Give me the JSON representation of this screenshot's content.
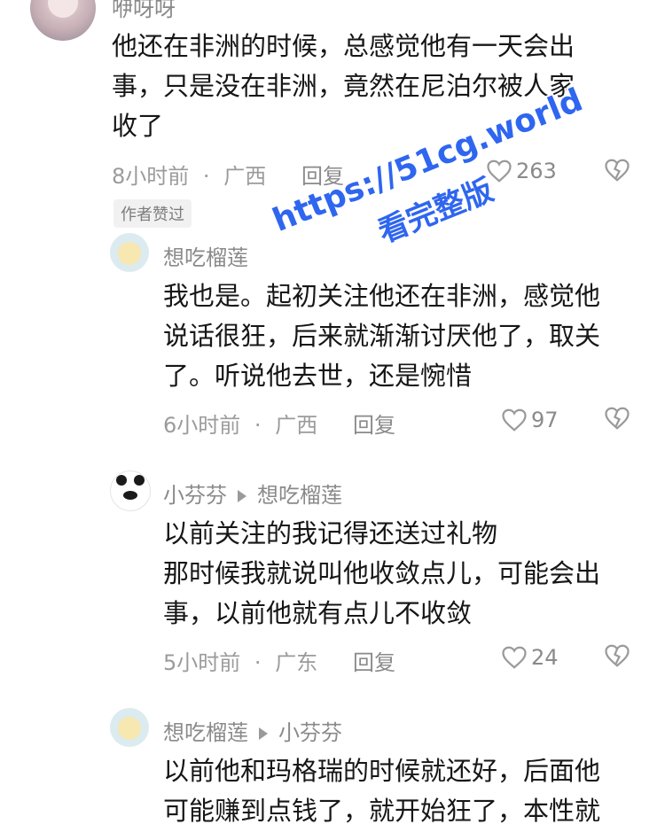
{
  "comments": [
    {
      "username": "咿呀呀",
      "lines": [
        "他还在非洲的时候，总感觉他有一天会出",
        "事，只是没在非洲，竟然在尼泊尔被人家",
        "收了"
      ],
      "time": "8小时前",
      "location": "广西",
      "reply_label": "回复",
      "likes": "263",
      "badge": "作者赞过"
    },
    {
      "username": "想吃榴莲",
      "lines": [
        "我也是。起初关注他还在非洲，感觉他",
        "说话很狂，后来就渐渐讨厌他了，取关",
        "了。听说他去世，还是惋惜"
      ],
      "time": "6小时前",
      "location": "广西",
      "reply_label": "回复",
      "likes": "97"
    },
    {
      "username": "小芬芬",
      "reply_to": "想吃榴莲",
      "lines": [
        "以前关注的我记得还送过礼物",
        "那时候我就说叫他收敛点儿，可能会出",
        "事，以前他就有点儿不收敛"
      ],
      "time": "5小时前",
      "location": "广东",
      "reply_label": "回复",
      "likes": "24"
    },
    {
      "username": "想吃榴莲",
      "reply_to": "小芬芬",
      "lines": [
        "以前他和玛格瑞的时候就还好，后面他",
        "可能赚到点钱了，就开始狂了，本性就"
      ]
    }
  ],
  "separator": "·",
  "watermark": {
    "line1": "https://51cg.world",
    "line2": "看完整版",
    "color": "#2f66f0"
  },
  "icons": {
    "like": "heart-outline-icon",
    "dislike": "broken-heart-icon"
  }
}
